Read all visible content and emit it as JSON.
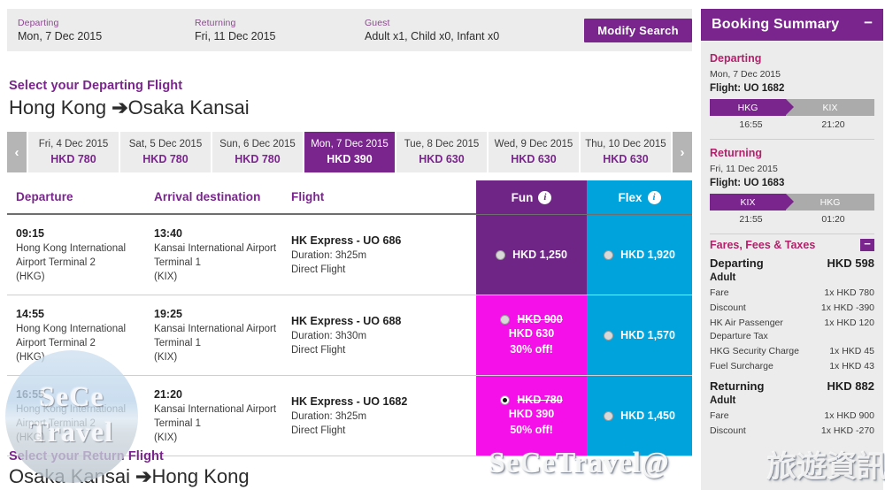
{
  "search_bar": {
    "departing_label": "Departing",
    "departing_value": "Mon, 7 Dec 2015",
    "returning_label": "Returning",
    "returning_value": "Fri, 11 Dec 2015",
    "guest_label": "Guest",
    "guest_value": "Adult x1, Child x0, Infant x0",
    "modify_button": "Modify Search"
  },
  "departing_section": {
    "select_title": "Select your Departing Flight",
    "route_from": "Hong Kong ",
    "route_arrow": "➔",
    "route_to": "Osaka Kansai"
  },
  "return_section": {
    "select_title": "Select your Return Flight",
    "route_from": "Osaka Kansai ",
    "route_arrow": "➔",
    "route_to": "Hong Kong"
  },
  "date_strip": {
    "prev_icon": "‹",
    "next_icon": "›",
    "dates": [
      {
        "day": "Fri, 4 Dec 2015",
        "price": "HKD 780",
        "selected": false
      },
      {
        "day": "Sat, 5 Dec 2015",
        "price": "HKD 780",
        "selected": false
      },
      {
        "day": "Sun, 6 Dec 2015",
        "price": "HKD 780",
        "selected": false
      },
      {
        "day": "Mon, 7 Dec 2015",
        "price": "HKD 390",
        "selected": true
      },
      {
        "day": "Tue, 8 Dec 2015",
        "price": "HKD 630",
        "selected": false
      },
      {
        "day": "Wed, 9 Dec 2015",
        "price": "HKD 630",
        "selected": false
      },
      {
        "day": "Thu, 10 Dec 2015",
        "price": "HKD 630",
        "selected": false
      }
    ]
  },
  "flight_table": {
    "headers": {
      "departure": "Departure",
      "arrival": "Arrival destination",
      "flight": "Flight",
      "fun": "Fun",
      "flex": "Flex",
      "info_glyph": "i"
    },
    "rows": [
      {
        "dep_time": "09:15",
        "dep_line1": "Hong Kong International",
        "dep_line2": "Airport Terminal 2",
        "dep_line3": "(HKG)",
        "arr_time": "13:40",
        "arr_line1": "Kansai International Airport",
        "arr_line2": "Terminal 1",
        "arr_line3": "(KIX)",
        "flight_name": "HK Express - UO 686",
        "duration": "Duration: 3h25m",
        "stops": "Direct Flight",
        "fun": {
          "price": "HKD 1,250",
          "sale": false,
          "selected": false,
          "old_price": "",
          "discount": ""
        },
        "flex": {
          "price": "HKD 1,920",
          "selected": false
        }
      },
      {
        "dep_time": "14:55",
        "dep_line1": "Hong Kong International",
        "dep_line2": "Airport Terminal 2",
        "dep_line3": "(HKG)",
        "arr_time": "19:25",
        "arr_line1": "Kansai International Airport",
        "arr_line2": "Terminal 1",
        "arr_line3": "(KIX)",
        "flight_name": "HK Express - UO 688",
        "duration": "Duration: 3h30m",
        "stops": "Direct Flight",
        "fun": {
          "price": "HKD 630",
          "sale": true,
          "selected": false,
          "old_price": "HKD 900",
          "discount": "30% off!"
        },
        "flex": {
          "price": "HKD 1,570",
          "selected": false
        }
      },
      {
        "dep_time": "16:55",
        "dep_line1": "Hong Kong International",
        "dep_line2": "Airport Terminal 2",
        "dep_line3": "(HKG)",
        "arr_time": "21:20",
        "arr_line1": "Kansai International Airport",
        "arr_line2": "Terminal 1",
        "arr_line3": "(KIX)",
        "flight_name": "HK Express - UO 1682",
        "duration": "Duration: 3h25m",
        "stops": "Direct Flight",
        "fun": {
          "price": "HKD 390",
          "sale": true,
          "selected": true,
          "old_price": "HKD 780",
          "discount": "50% off!"
        },
        "flex": {
          "price": "HKD 1,450",
          "selected": false
        }
      }
    ]
  },
  "sidebar": {
    "title": "Booking Summary",
    "collapse_icon": "−",
    "departing": {
      "title": "Departing",
      "date": "Mon, 7 Dec 2015",
      "flight": "Flight: UO 1682",
      "from_code": "HKG",
      "to_code": "KIX",
      "dep_time": "16:55",
      "arr_time": "21:20"
    },
    "returning": {
      "title": "Returning",
      "date": "Fri, 11 Dec 2015",
      "flight": "Flight: UO 1683",
      "from_code": "KIX",
      "to_code": "HKG",
      "dep_time": "21:55",
      "arr_time": "01:20"
    },
    "fares": {
      "title": "Fares, Fees & Taxes",
      "collapse_icon": "−",
      "departing_label": "Departing",
      "departing_total": "HKD 598",
      "departing_pax": "Adult",
      "departing_lines": [
        {
          "label": "Fare",
          "value": "1x HKD 780"
        },
        {
          "label": "Discount",
          "value": "1x HKD -390"
        },
        {
          "label": "HK Air Passenger Departure Tax",
          "value": "1x HKD 120"
        },
        {
          "label": "HKG Security Charge",
          "value": "1x HKD 45"
        },
        {
          "label": "Fuel Surcharge",
          "value": "1x HKD 43"
        }
      ],
      "returning_label": "Returning",
      "returning_total": "HKD 882",
      "returning_pax": "Adult",
      "returning_lines": [
        {
          "label": "Fare",
          "value": "1x HKD 900"
        },
        {
          "label": "Discount",
          "value": "1x HKD -270"
        }
      ]
    }
  },
  "watermarks": {
    "circle_line1": "SeCe",
    "circle_line2": "Travel",
    "big_text": "SeCeTravel@",
    "cjk_text": "旅遊資訊"
  }
}
